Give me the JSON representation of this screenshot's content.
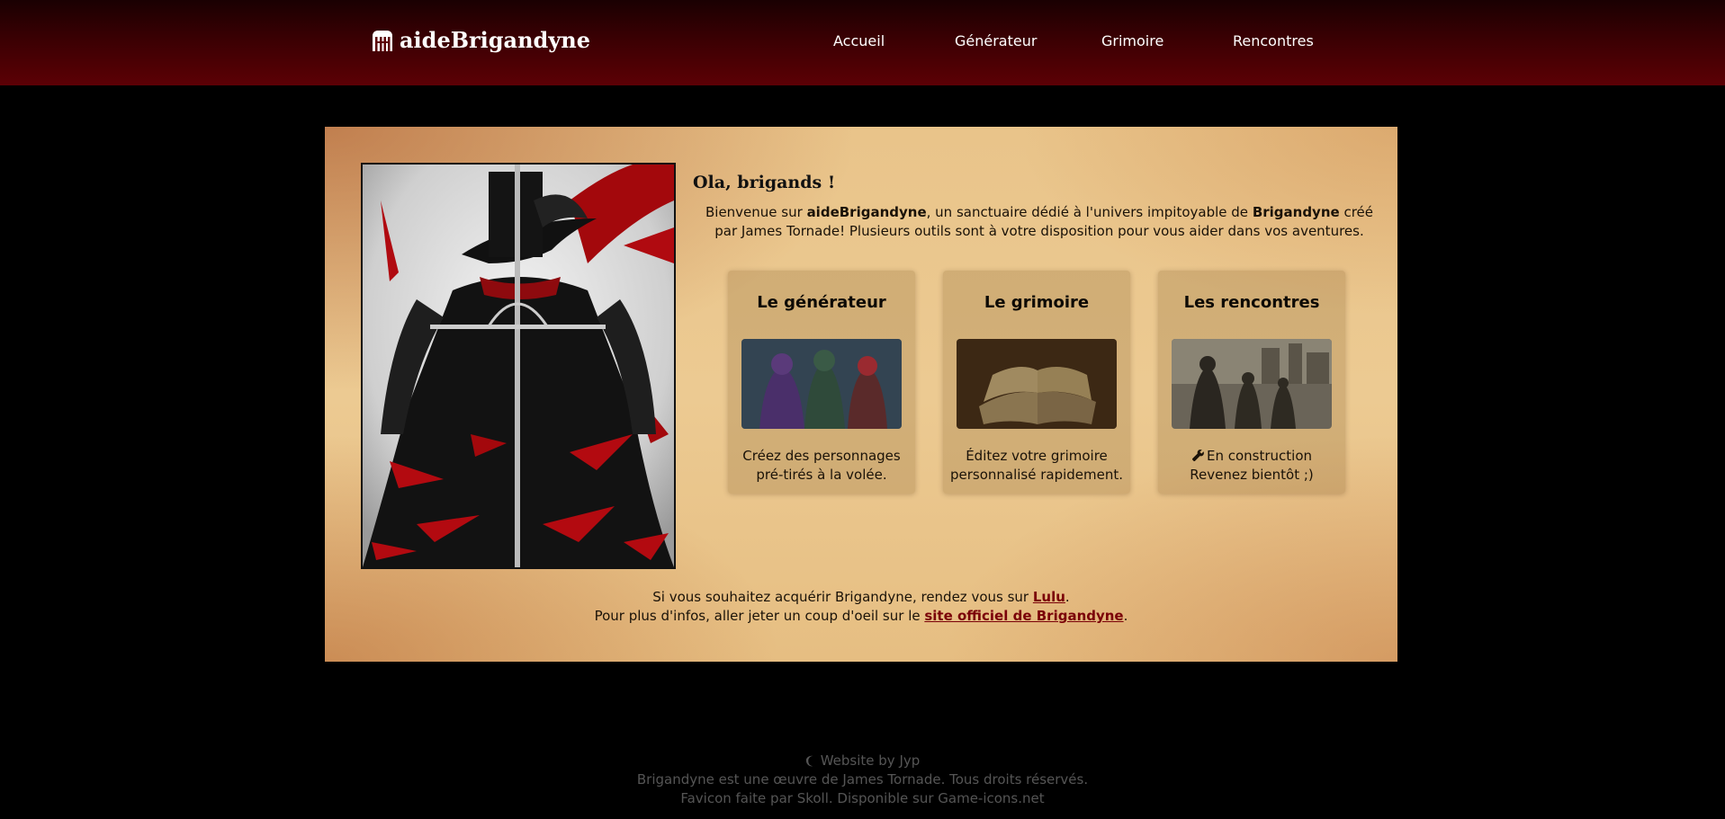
{
  "header": {
    "brand": "aideBrigandyne",
    "brand_icon": "castle-gate-icon",
    "nav": [
      {
        "label": "Accueil"
      },
      {
        "label": "Générateur"
      },
      {
        "label": "Grimoire"
      },
      {
        "label": "Rencontres"
      }
    ]
  },
  "main": {
    "greeting": "Ola, brigands !",
    "intro": {
      "p1": "Bienvenue sur ",
      "b1": "aideBrigandyne",
      "p2": ", un sanctuaire dédié à l'univers impitoyable de ",
      "b2": "Brigandyne",
      "p3": " créé par James Tornade! Plusieurs outils sont à votre disposition pour vous aider dans vos aventures."
    },
    "cards": [
      {
        "title": "Le générateur",
        "line1": "Créez des personnages",
        "line2": "pré-tirés à la volée."
      },
      {
        "title": "Le grimoire",
        "line1": "Éditez votre grimoire",
        "line2": "personnalisé rapidement."
      },
      {
        "title": "Les rencontres",
        "icon": "wrench-icon",
        "line1": "En construction",
        "line2": "Revenez bientôt ;)"
      }
    ],
    "links": {
      "l1_pre": "Si vous souhaitez acquérir Brigandyne, rendez vous sur ",
      "l1_link": "Lulu",
      "l1_post": ".",
      "l2_pre": "Pour plus d'infos, aller jeter un coup d'oeil sur le ",
      "l2_link": "site officiel de Brigandyne",
      "l2_post": "."
    }
  },
  "footer": {
    "line1": "Website by Jyp",
    "line1_icon": "moon-icon",
    "line2": "Brigandyne est une œuvre de James Tornade. Tous droits réservés.",
    "line3": "Favicon faite par Skoll. Disponible sur Game-icons.net"
  },
  "colors": {
    "header_dark": "#1a0002",
    "header_red": "#5c0005",
    "link": "#7a0008",
    "parchment": "#ecca92"
  }
}
